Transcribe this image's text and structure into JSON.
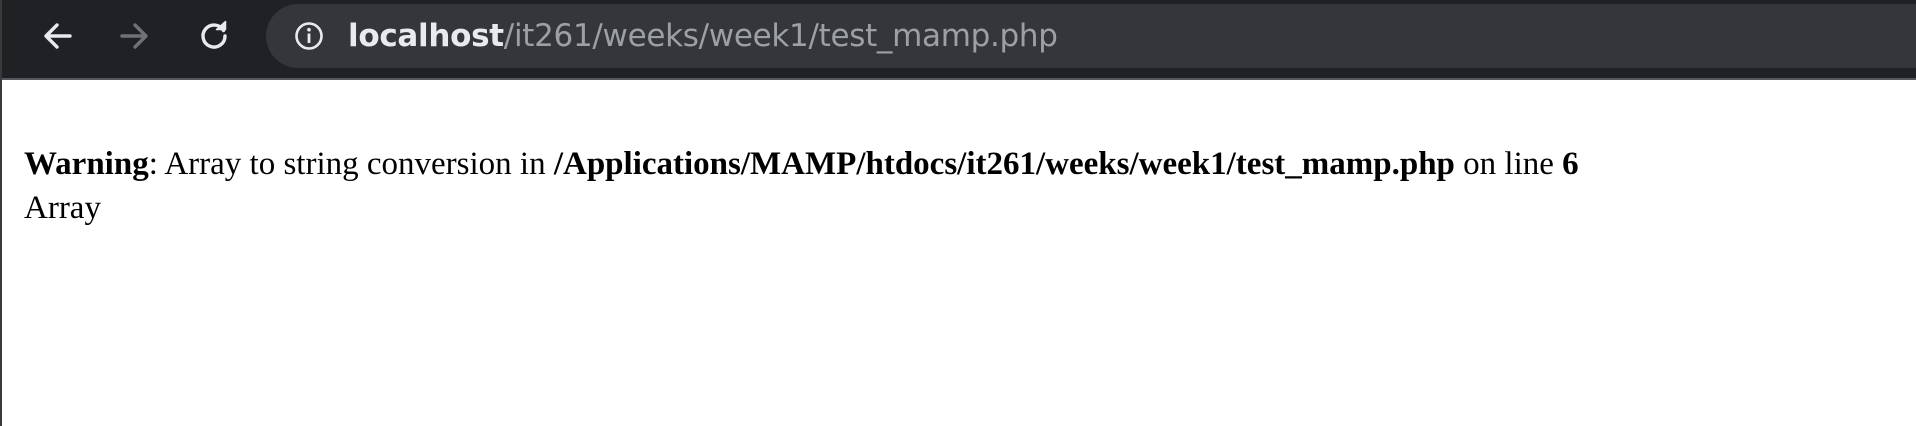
{
  "browser": {
    "back_icon": "arrow-left-icon",
    "forward_icon": "arrow-right-icon",
    "reload_icon": "reload-icon",
    "site_info_icon": "info-icon",
    "url_host": "localhost",
    "url_path": "/it261/weeks/week1/test_mamp.php",
    "colors": {
      "toolbar_bg": "#202124",
      "omnibox_bg": "#35363a",
      "host_text": "#e8eaed",
      "path_text": "#9aa0a6"
    }
  },
  "page": {
    "warning_label": "Warning",
    "message_sep": ": ",
    "message_text": "Array to string conversion in ",
    "file_path": "/Applications/MAMP/htdocs/it261/weeks/week1/test_mamp.php",
    "on_line_text": " on line ",
    "line_number": "6",
    "output": "Array"
  }
}
